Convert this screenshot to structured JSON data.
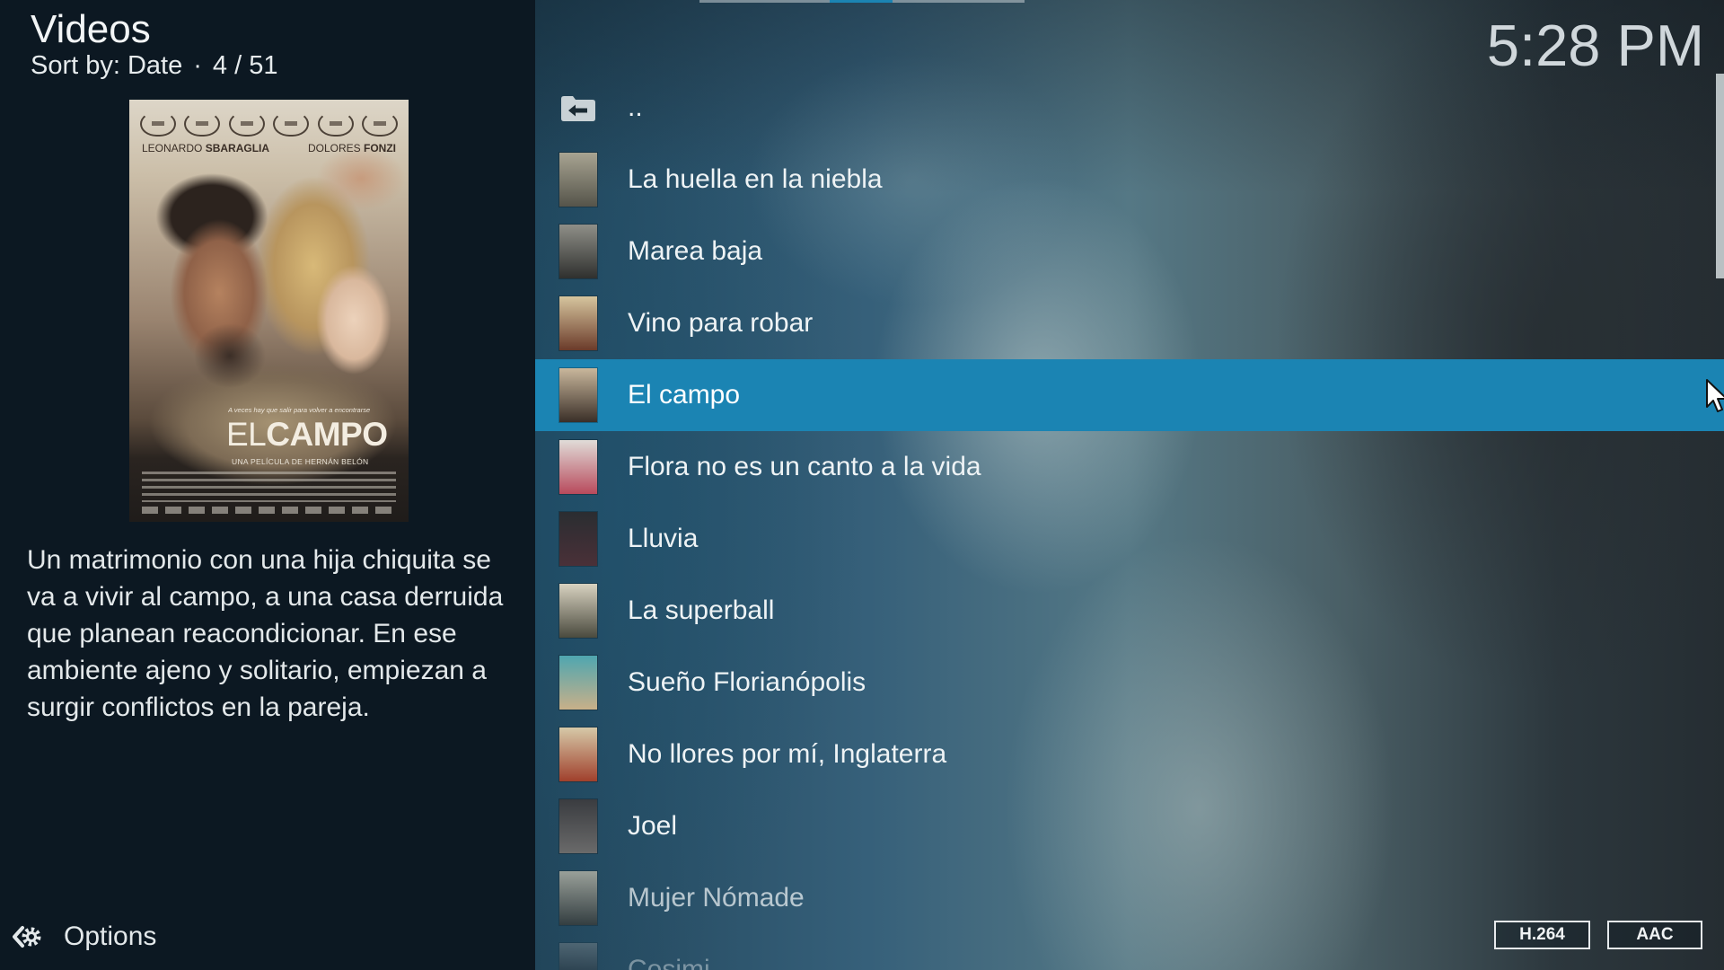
{
  "header": {
    "title": "Videos",
    "sort_label": "Sort by: Date",
    "separator": "·",
    "position": "4 / 51"
  },
  "clock": {
    "time": "5:28 PM"
  },
  "poster": {
    "cast": [
      {
        "first": "LEONARDO",
        "last": "SBARAGLIA"
      },
      {
        "first": "DOLORES",
        "last": "FONZI"
      }
    ],
    "tagline": "A veces hay que salir para volver a encontrarse",
    "title_light": "EL",
    "title_bold": "CAMPO",
    "director_line": "UNA PELÍCULA DE HERNÁN BELÓN"
  },
  "plot": "Un matrimonio con una hija chiquita se va a vivir al campo, a una casa derruida que planean reacondicionar. En ese ambiente ajeno y solitario, empiezan a surgir conflictos en la pareja.",
  "options": {
    "label": "Options",
    "icon": "options-icon"
  },
  "list": {
    "selected_index": 4,
    "items": [
      {
        "title": "..",
        "icon": "folder-back-icon"
      },
      {
        "title": "La huella en la niebla",
        "thumb": [
          "#a8a492",
          "#55544a"
        ]
      },
      {
        "title": "Marea baja",
        "thumb": [
          "#8f8f88",
          "#2f302e"
        ]
      },
      {
        "title": "Vino para robar",
        "thumb": [
          "#d6c59e",
          "#6b3b2a"
        ]
      },
      {
        "title": "El campo",
        "thumb": [
          "#c9b79c",
          "#3a2f28"
        ]
      },
      {
        "title": "Flora no es un canto a la vida",
        "thumb": [
          "#e0dcd8",
          "#b84a5c"
        ]
      },
      {
        "title": "Lluvia",
        "thumb": [
          "#2a2d31",
          "#4a3038"
        ]
      },
      {
        "title": "La superball",
        "thumb": [
          "#d8d2c0",
          "#4a4a3e"
        ]
      },
      {
        "title": "Sueño Florianópolis",
        "thumb": [
          "#4fa6b0",
          "#c8b089"
        ]
      },
      {
        "title": "No llores por mí, Inglaterra",
        "thumb": [
          "#d6c9a8",
          "#a0402c"
        ]
      },
      {
        "title": "Joel",
        "thumb": [
          "#3a3c40",
          "#6a6a6a"
        ]
      },
      {
        "title": "Mujer Nómade",
        "thumb": [
          "#c8c2b0",
          "#3a3a36"
        ]
      },
      {
        "title": "Cosimi",
        "thumb": [
          "#8a8e90",
          "#3e4044"
        ]
      }
    ]
  },
  "badges": {
    "video_codec": "H.264",
    "audio_codec": "AAC"
  },
  "colors": {
    "accent": "#1b84b3",
    "panel": "#0c1822",
    "text": "#eef3f5"
  }
}
